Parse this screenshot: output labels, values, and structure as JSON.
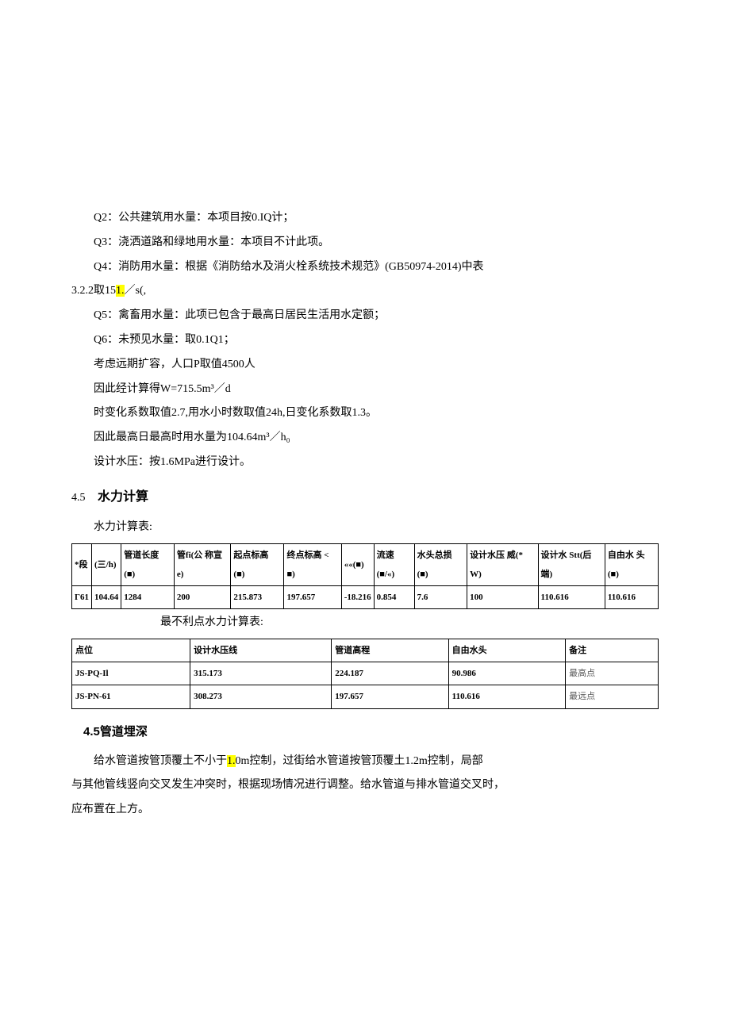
{
  "paragraphs": {
    "p1": "Q2：公共建筑用水量：本项目按0.IQ计；",
    "p2": "Q3：浇洒道路和绿地用水量：本项目不计此项。",
    "p3": "Q4：消防用水量：根据《消防给水及消火栓系统技术规范》(GB50974-2014)中表",
    "p3b_a": "3.2.2取15",
    "p3b_hl": "1.",
    "p3b_b": "／s(,",
    "p4": "Q5：禽畜用水量：此项已包含于最高日居民生活用水定额；",
    "p5": "Q6：未预见水量：取0.1Q1；",
    "p6": "考虑远期扩容，人口P取值4500人",
    "p7": "因此经计算得W=715.5m³／d",
    "p8": "时变化系数取值2.7,用水小时数取值24h,日变化系数取1.3。",
    "p9": "因此最高日最高时用水量为104.64m³／h₀",
    "p10": "设计水压：按1.6MPa进行设计。"
  },
  "sec45_num": "4.5",
  "sec45_txt": "水力计算",
  "table1_caption": "水力计算表:",
  "table1": {
    "headers": [
      "*段",
      "(三/h)",
      "管道长度\n(■)",
      "管fi(公\n称宣e)",
      "起点标高\n(■)",
      "终点标高\n< ■)",
      "««(■)",
      "流速(■/«)",
      "水头总损\n(■)",
      "设计水压\n威(*\nW)",
      "设计水\nStt(后端)",
      "自由水\n头(■)"
    ],
    "row": [
      "Γ61",
      "104.64",
      "1284",
      "200",
      "215.873",
      "197.657",
      "-18.216",
      "0.854",
      "7.6",
      "100",
      "110.616",
      "110.616"
    ]
  },
  "table2_caption": "最不利点水力计算表:",
  "table2": {
    "headers": [
      "点位",
      "设计水压线",
      "管道高程",
      "自由水头",
      "备注"
    ],
    "rows": [
      [
        "JS-PQ-Il",
        "315.173",
        "224.187",
        "90.986",
        "最高点"
      ],
      [
        "JS-PN-61",
        "308.273",
        "197.657",
        "110.616",
        "最远点"
      ]
    ]
  },
  "sec45b": "4.5管道埋深",
  "p11a": "给水管道按管顶覆土不小于",
  "p11hl": "1.",
  "p11b": "0m控制，过街给水管道按管顶覆土1.2m控制，局部",
  "p12": "与其他管线竖向交叉发生冲突时，根据现场情况进行调整。给水管道与排水管道交叉时，",
  "p13": "应布置在上方。"
}
